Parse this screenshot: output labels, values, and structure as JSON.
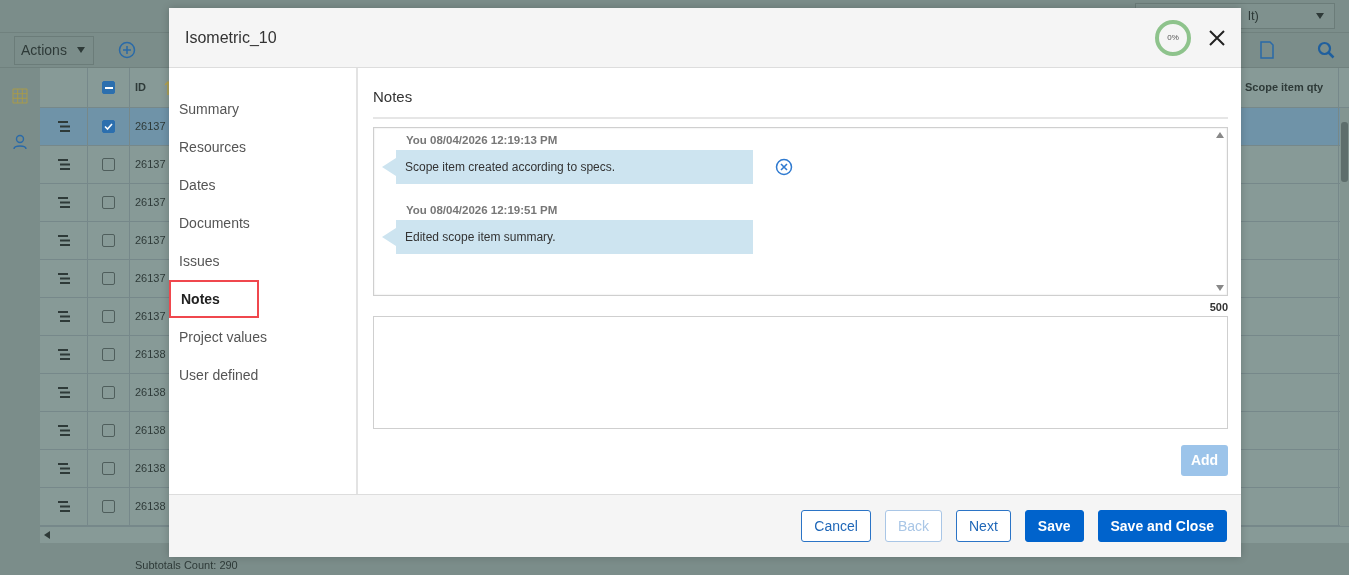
{
  "background": {
    "view_dropdown": "lt)",
    "actions_menu": "Actions",
    "table": {
      "header_checkbox_indeterminate": true,
      "columns": [
        "ID",
        "Scope item qty"
      ],
      "rows": [
        {
          "id": "26137",
          "checked": true,
          "selected": true
        },
        {
          "id": "26137",
          "checked": false,
          "selected": false
        },
        {
          "id": "26137",
          "checked": false,
          "selected": false
        },
        {
          "id": "26137",
          "checked": false,
          "selected": false
        },
        {
          "id": "26137",
          "checked": false,
          "selected": false
        },
        {
          "id": "26137",
          "checked": false,
          "selected": false
        },
        {
          "id": "26138",
          "checked": false,
          "selected": false
        },
        {
          "id": "26138",
          "checked": false,
          "selected": false
        },
        {
          "id": "26138",
          "checked": false,
          "selected": false
        },
        {
          "id": "26138",
          "checked": false,
          "selected": false
        },
        {
          "id": "26138",
          "checked": false,
          "selected": false
        }
      ]
    },
    "subtotals": "Subtotals Count: 290"
  },
  "dialog": {
    "title": "Isometric_10",
    "progress": "0%",
    "nav": [
      {
        "label": "Summary",
        "selected": false
      },
      {
        "label": "Resources",
        "selected": false
      },
      {
        "label": "Dates",
        "selected": false
      },
      {
        "label": "Documents",
        "selected": false
      },
      {
        "label": "Issues",
        "selected": false
      },
      {
        "label": "Notes",
        "selected": true
      },
      {
        "label": "Project values",
        "selected": false
      },
      {
        "label": "User defined",
        "selected": false
      }
    ],
    "section_title": "Notes",
    "notes": [
      {
        "meta": "You 08/04/2026 12:19:13 PM",
        "text": "Scope item created according to specs.",
        "deletable": true
      },
      {
        "meta": "You 08/04/2026 12:19:51 PM",
        "text": "Edited scope item summary.",
        "deletable": false
      }
    ],
    "char_counter": "500",
    "add_button": {
      "label": "Add",
      "disabled": true
    },
    "buttons": [
      {
        "label": "Cancel",
        "kind": "outline",
        "disabled": false
      },
      {
        "label": "Back",
        "kind": "outline",
        "disabled": true
      },
      {
        "label": "Next",
        "kind": "outline",
        "disabled": false
      },
      {
        "label": "Save",
        "kind": "primary",
        "disabled": false
      },
      {
        "label": "Save and Close",
        "kind": "primary",
        "disabled": false
      }
    ]
  }
}
